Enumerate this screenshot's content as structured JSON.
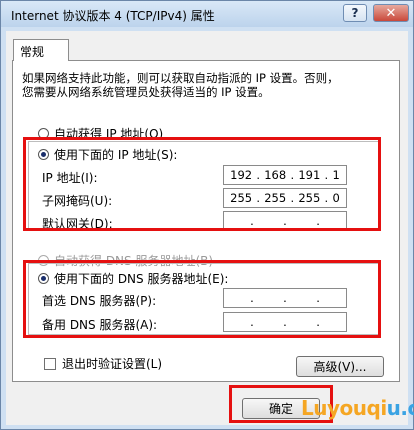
{
  "window": {
    "title": "Internet 协议版本 4 (TCP/IPv4) 属性",
    "help_glyph": "?",
    "close_glyph": "✕"
  },
  "tab": {
    "label": "常规"
  },
  "description": {
    "line1": "如果网络支持此功能，则可以获取自动指派的 IP 设置。否则，",
    "line2": "您需要从网络系统管理员处获得适当的 IP 设置。"
  },
  "ip_section": {
    "auto_label": "自动获得 IP 地址(O)",
    "manual_label": "使用下面的 IP 地址(S):",
    "fields": [
      {
        "label": "IP 地址(I):",
        "octets": [
          "192",
          "168",
          "191",
          "1"
        ]
      },
      {
        "label": "子网掩码(U):",
        "octets": [
          "255",
          "255",
          "255",
          "0"
        ]
      },
      {
        "label": "默认网关(D):",
        "octets": [
          "",
          "",
          "",
          ""
        ]
      }
    ]
  },
  "dns_section": {
    "auto_label": "自动获得 DNS 服务器地址(B)",
    "manual_label": "使用下面的 DNS 服务器地址(E):",
    "fields": [
      {
        "label": "首选 DNS 服务器(P):",
        "octets": [
          "",
          "",
          "",
          ""
        ]
      },
      {
        "label": "备用 DNS 服务器(A):",
        "octets": [
          "",
          "",
          "",
          ""
        ]
      }
    ]
  },
  "validate_checkbox": {
    "label": "退出时验证设置(L)",
    "checked": false
  },
  "buttons": {
    "advanced": "高级(V)...",
    "ok": "确定"
  },
  "watermark": {
    "part1": "Luyouqi",
    "part2": "u.cn"
  },
  "colors": {
    "highlight_box": "#e51010",
    "selected_radio": "#1a2e6b"
  }
}
